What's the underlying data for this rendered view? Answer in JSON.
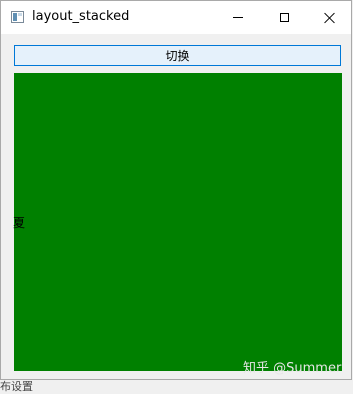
{
  "window": {
    "title": "layout_stacked",
    "icons": {
      "app": "app-window-icon",
      "minimize": "minimize-icon",
      "maximize": "maximize-icon",
      "close": "close-icon"
    }
  },
  "toolbar": {
    "switch_label": "切换"
  },
  "stack": {
    "panel_color": "#008000",
    "page_label": "夏"
  },
  "watermark": "知乎 @Summer",
  "background": {
    "fragment": "布设置"
  },
  "colors": {
    "button_bg": "#e5f1fb",
    "button_border": "#0078d7",
    "window_bg": "#f0f0f0"
  }
}
